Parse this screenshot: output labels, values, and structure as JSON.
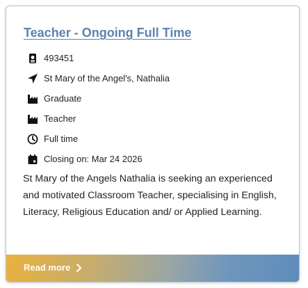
{
  "job": {
    "title": "Teacher - Ongoing Full Time",
    "details": [
      {
        "icon": "id-badge-icon",
        "text": "493451"
      },
      {
        "icon": "location-arrow-icon",
        "text": "St Mary of the Angel's, Nathalia"
      },
      {
        "icon": "industry-icon",
        "text": "Graduate"
      },
      {
        "icon": "industry-icon",
        "text": "Teacher"
      },
      {
        "icon": "clock-icon",
        "text": "Full time"
      },
      {
        "icon": "calendar-icon",
        "text": "Closing on: Mar 24 2026"
      }
    ],
    "description": "St Mary of the Angels Nathalia is seeking an experienced and motivated Classroom Teacher, specialising in English, Literacy, Religious Education and/ or Applied Learning.",
    "read_more_label": "Read more"
  },
  "colors": {
    "title_link": "#5b82ad",
    "footer_gradient_start": "#e8b13e",
    "footer_gradient_end": "#5e8cba"
  }
}
